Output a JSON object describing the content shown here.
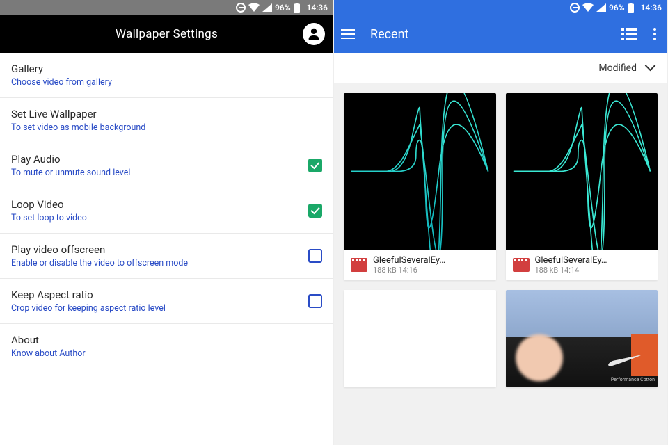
{
  "left": {
    "status": {
      "battery_pct": "96%",
      "time": "14:36"
    },
    "appbar": {
      "title": "Wallpaper Settings"
    },
    "settings": [
      {
        "title": "Gallery",
        "sub": "Choose video from gallery",
        "check": null
      },
      {
        "title": "Set Live Wallpaper",
        "sub": "To set video as mobile background",
        "check": null
      },
      {
        "title": "Play Audio",
        "sub": "To mute or unmute sound level",
        "check": true
      },
      {
        "title": "Loop Video",
        "sub": "To set loop to video",
        "check": true
      },
      {
        "title": "Play video offscreen",
        "sub": "Enable or disable the video to offscreen mode",
        "check": false
      },
      {
        "title": "Keep Aspect ratio",
        "sub": "Crop video for keeping aspect ratio level",
        "check": false
      },
      {
        "title": "About",
        "sub": "Know about Author",
        "check": null
      }
    ]
  },
  "right": {
    "status": {
      "battery_pct": "96%",
      "time": "14:36"
    },
    "appbar": {
      "title": "Recent"
    },
    "sort": {
      "label": "Modified"
    },
    "files": [
      {
        "name": "GleefulSeveralEy…",
        "meta": "188 kB 14:16",
        "thumb": "wave"
      },
      {
        "name": "GleefulSeveralEy…",
        "meta": "188 kB 14:14",
        "thumb": "wave"
      },
      {
        "name": "",
        "meta": "",
        "thumb": "blank"
      },
      {
        "name": "",
        "meta": "",
        "thumb": "photo"
      }
    ],
    "photo_caption": "Performance Cotton"
  },
  "colors": {
    "blue": "#2f6fe0",
    "subblue": "#2a4cc6",
    "green": "#1aa868",
    "red": "#d23f3f"
  }
}
